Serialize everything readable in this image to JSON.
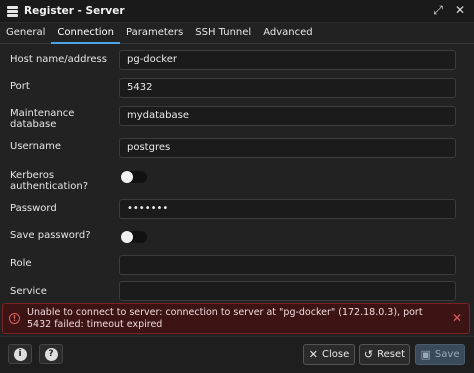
{
  "window": {
    "title": "Register - Server"
  },
  "tabs": [
    {
      "label": "General"
    },
    {
      "label": "Connection"
    },
    {
      "label": "Parameters"
    },
    {
      "label": "SSH Tunnel"
    },
    {
      "label": "Advanced"
    }
  ],
  "active_tab": "Connection",
  "fields": {
    "host": {
      "label": "Host name/address",
      "value": "pg-docker"
    },
    "port": {
      "label": "Port",
      "value": "5432"
    },
    "maintenance_db": {
      "label_line1": "Maintenance",
      "label_line2": "database",
      "value": "mydatabase"
    },
    "username": {
      "label": "Username",
      "value": "postgres"
    },
    "kerberos": {
      "label_line1": "Kerberos",
      "label_line2": "authentication?",
      "value": false
    },
    "password": {
      "label": "Password",
      "value": "•••••••"
    },
    "save_password": {
      "label": "Save password?",
      "value": false
    },
    "role": {
      "label": "Role",
      "value": ""
    },
    "service": {
      "label": "Service",
      "value": ""
    }
  },
  "error": {
    "message": "Unable to connect to server: connection to server at \"pg-docker\" (172.18.0.3), port 5432 failed: timeout expired"
  },
  "footer": {
    "info_icon": "info-icon",
    "help_icon": "help-icon",
    "close_label": "Close",
    "reset_label": "Reset",
    "save_label": "Save"
  },
  "colors": {
    "accent": "#4aa3e6",
    "error_bg": "#3d1414",
    "error_border": "#7a2323",
    "background": "#222222"
  }
}
